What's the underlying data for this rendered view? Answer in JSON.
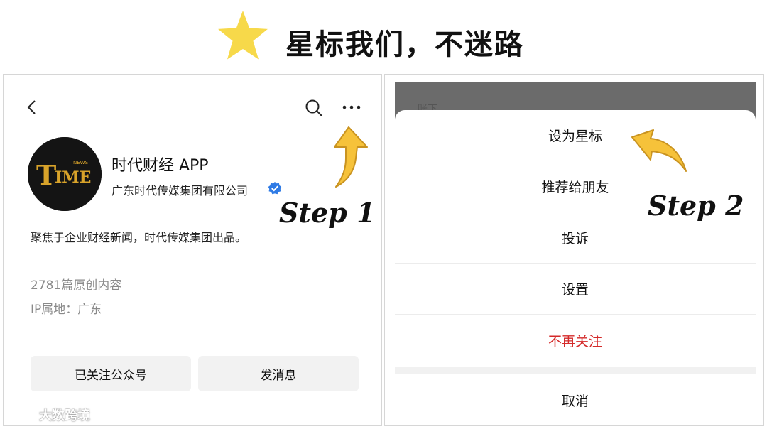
{
  "header": {
    "title": "星标我们，不迷路",
    "star_icon": "star-icon",
    "star_color": "#f7d94a"
  },
  "profile": {
    "name": "时代财经 APP",
    "org": "广东时代传媒集团有限公司",
    "bio": "聚焦于企业财经新闻，时代传媒集团出品。",
    "posts": "2781篇原创内容",
    "ip": "IP属地：广东",
    "avatar": {
      "logo_text": "TIME",
      "logo_small": "NEWS",
      "gold": "#d8a32a"
    },
    "buttons": {
      "followed": "已关注公众号",
      "message": "发消息"
    },
    "verified_color": "#2f7be5"
  },
  "steps": {
    "step1": "Step 1",
    "step2": "Step 2"
  },
  "sheet": {
    "behind_text": "账下",
    "items": [
      {
        "label": "设为星标"
      },
      {
        "label": "推荐给朋友"
      },
      {
        "label": "投诉"
      },
      {
        "label": "设置"
      },
      {
        "label": "不再关注"
      }
    ],
    "cancel": "取消",
    "danger_color": "#d42a2a"
  },
  "watermark": {
    "text": "大数跨境"
  }
}
